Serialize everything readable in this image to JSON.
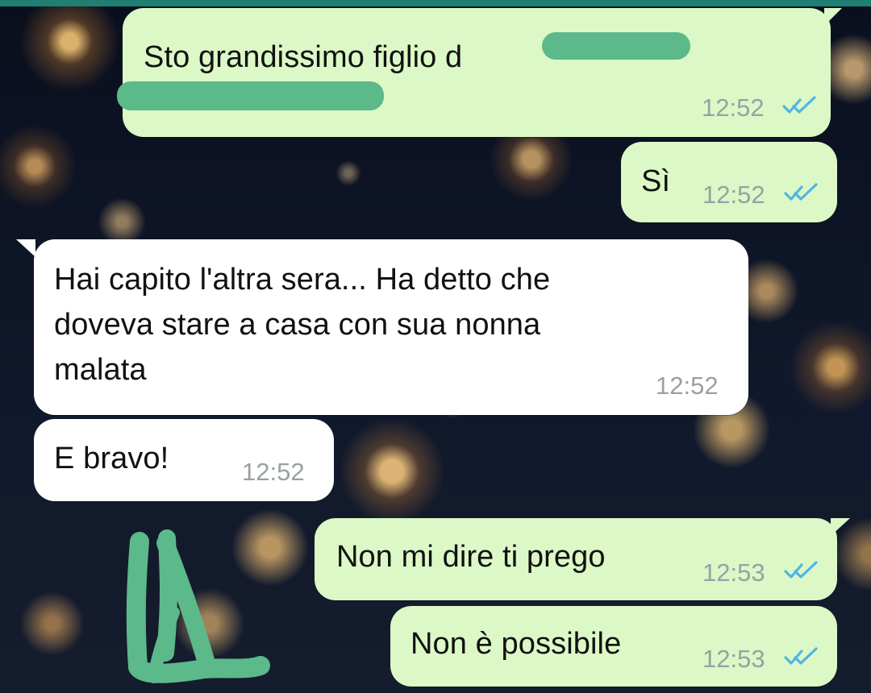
{
  "chat": {
    "messages": [
      {
        "direction": "outgoing",
        "text": "Sto grandissimo figlio d",
        "time": "12:52",
        "status": "read",
        "redacted": true
      },
      {
        "direction": "outgoing",
        "text": "Sì",
        "time": "12:52",
        "status": "read"
      },
      {
        "direction": "incoming",
        "text": "Hai capito l'altra sera... Ha detto che\ndoveva stare a casa con sua nonna\nmalata",
        "time": "12:52"
      },
      {
        "direction": "incoming",
        "text": "E bravo!",
        "time": "12:52"
      },
      {
        "direction": "outgoing",
        "text": "Non mi dire ti prego",
        "time": "12:53",
        "status": "read"
      },
      {
        "direction": "outgoing",
        "text": "Non è possibile",
        "time": "12:53",
        "status": "read"
      }
    ]
  },
  "colors": {
    "outgoing_bubble": "#dcf8c6",
    "incoming_bubble": "#ffffff",
    "read_check": "#4fb5e5",
    "time_text": "#99a0a3",
    "redaction": "#5bb98a",
    "header_bar": "#1f7f72"
  },
  "icons": {
    "read_receipt": "double-check-icon"
  }
}
